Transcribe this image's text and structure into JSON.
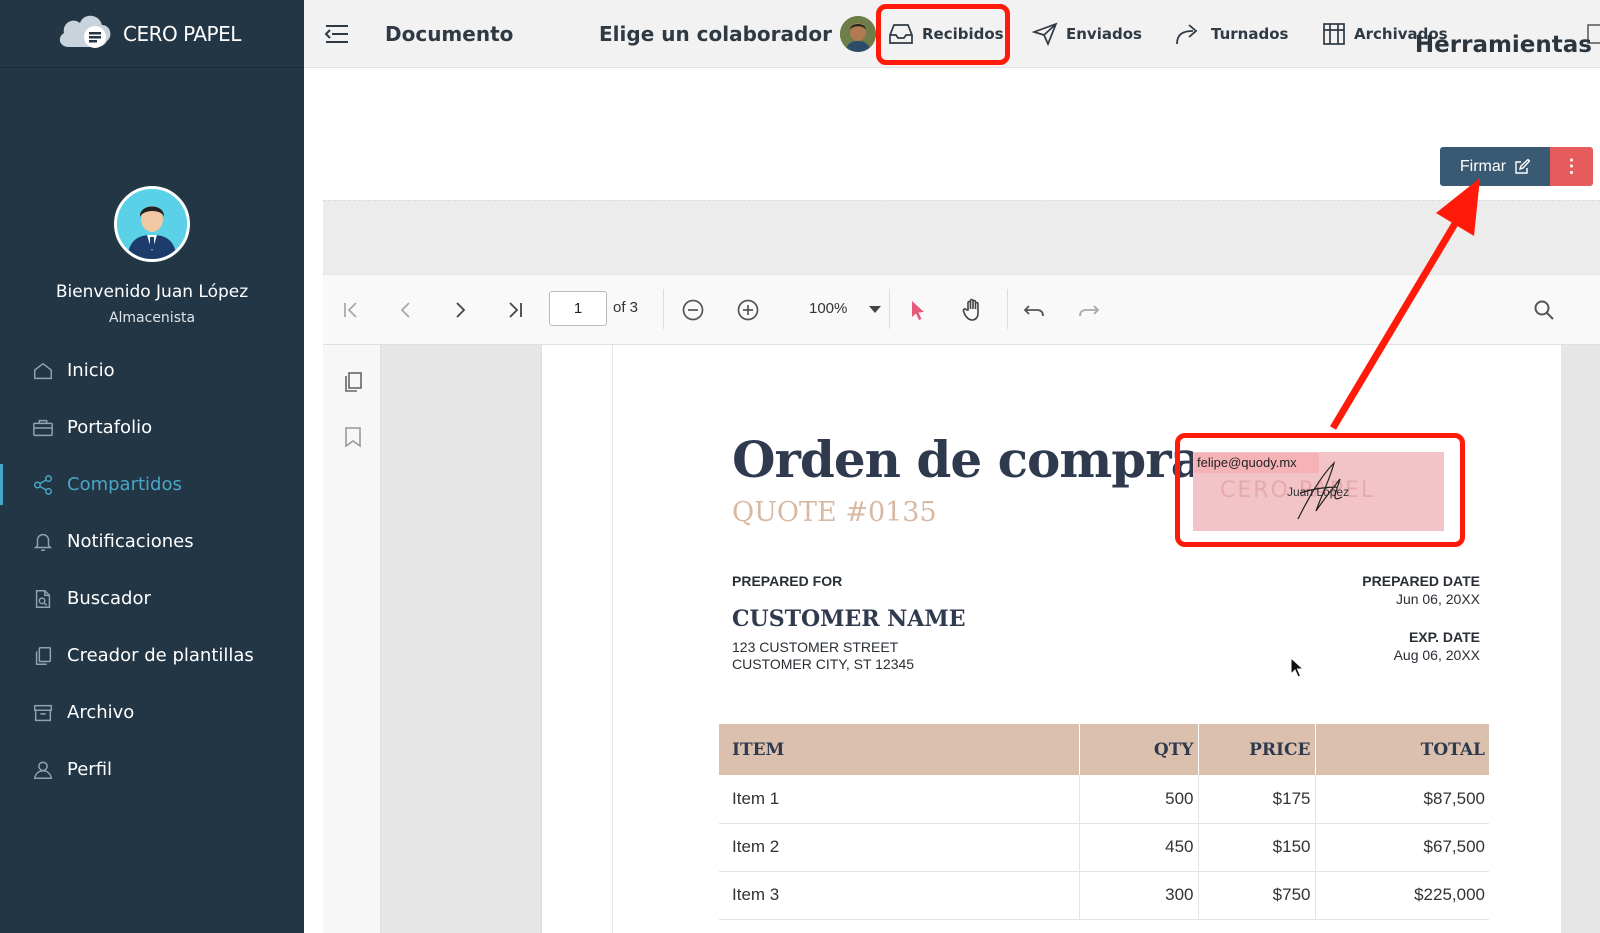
{
  "app": {
    "brand": "CERO PAPEL"
  },
  "user": {
    "welcome": "Bienvenido Juan López",
    "role": "Almacenista"
  },
  "sidebar": {
    "items": [
      {
        "label": "Inicio",
        "icon": "home-icon"
      },
      {
        "label": "Portafolio",
        "icon": "briefcase-icon"
      },
      {
        "label": "Compartidos",
        "icon": "share-icon",
        "active": true
      },
      {
        "label": "Notificaciones",
        "icon": "bell-icon"
      },
      {
        "label": "Buscador",
        "icon": "document-search-icon"
      },
      {
        "label": "Creador de plantillas",
        "icon": "copy-icon"
      },
      {
        "label": "Archivo",
        "icon": "archive-icon"
      },
      {
        "label": "Perfil",
        "icon": "user-icon"
      }
    ]
  },
  "topbar": {
    "section_title": "Documento",
    "collaborator_label": "Elige un colaborador",
    "tabs": [
      {
        "label": "Recibidos",
        "icon": "inbox-icon"
      },
      {
        "label": "Enviados",
        "icon": "send-icon"
      },
      {
        "label": "Turnados",
        "icon": "forward-icon"
      },
      {
        "label": "Archivados",
        "icon": "columns-icon"
      }
    ]
  },
  "tools": {
    "heading": "Herramientas",
    "sign_label": "Firmar",
    "more_label": "⋮"
  },
  "viewer": {
    "page_current": "1",
    "page_total_label": "of 3",
    "zoom": "100%"
  },
  "document": {
    "title": "Orden de compra",
    "quote": "QUOTE #0135",
    "prepared_for_label": "PREPARED FOR",
    "customer_name": "CUSTOMER NAME",
    "address1": "123 CUSTOMER STREET",
    "address2": "CUSTOMER CITY, ST 12345",
    "prepared_date_label": "PREPARED DATE",
    "prepared_date": "Jun 06, 20XX",
    "exp_date_label": "EXP. DATE",
    "exp_date": "Aug 06, 20XX",
    "signature": {
      "email": "felipe@quody.mx",
      "brand": "CERO PAPEL",
      "signer": "Juan López"
    },
    "table": {
      "headers": [
        "ITEM",
        "QTY",
        "PRICE",
        "TOTAL"
      ],
      "rows": [
        [
          "Item 1",
          "500",
          "$175",
          "$87,500"
        ],
        [
          "Item 2",
          "450",
          "$150",
          "$67,500"
        ],
        [
          "Item 3",
          "300",
          "$750",
          "$225,000"
        ]
      ]
    }
  },
  "colors": {
    "sidebar": "#233645",
    "accent": "#4aa6c6",
    "highlight": "#ff1a0a",
    "sign_button": "#3a5a73",
    "more_button": "#e65c5c"
  }
}
